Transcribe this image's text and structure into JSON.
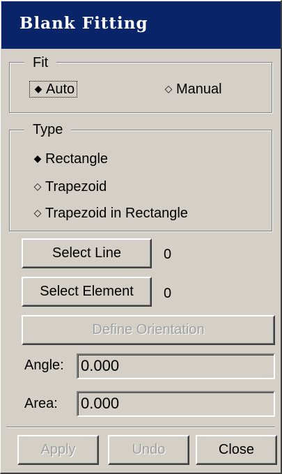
{
  "window": {
    "title": "Blank Fitting"
  },
  "fit_group": {
    "legend": "Fit",
    "options": [
      {
        "label": "Auto",
        "selected": true
      },
      {
        "label": "Manual",
        "selected": false
      }
    ]
  },
  "type_group": {
    "legend": "Type",
    "options": [
      {
        "label": "Rectangle",
        "selected": true
      },
      {
        "label": "Trapezoid",
        "selected": false
      },
      {
        "label": "Trapezoid in Rectangle",
        "selected": false
      }
    ]
  },
  "selection": {
    "select_line_label": "Select Line",
    "select_line_count": "0",
    "select_element_label": "Select Element",
    "select_element_count": "0",
    "define_orientation_label": "Define Orientation"
  },
  "fields": {
    "angle_label": "Angle:",
    "angle_value": "0.000",
    "area_label": "Area:",
    "area_value": "0.000"
  },
  "footer": {
    "apply_label": "Apply",
    "undo_label": "Undo",
    "close_label": "Close"
  },
  "symbols": {
    "radio_on": "◆",
    "radio_off": "◇"
  },
  "colors": {
    "titlebar": "#0a246a",
    "face": "#d4d0c8",
    "disabled_text": "#a0a0a0"
  }
}
